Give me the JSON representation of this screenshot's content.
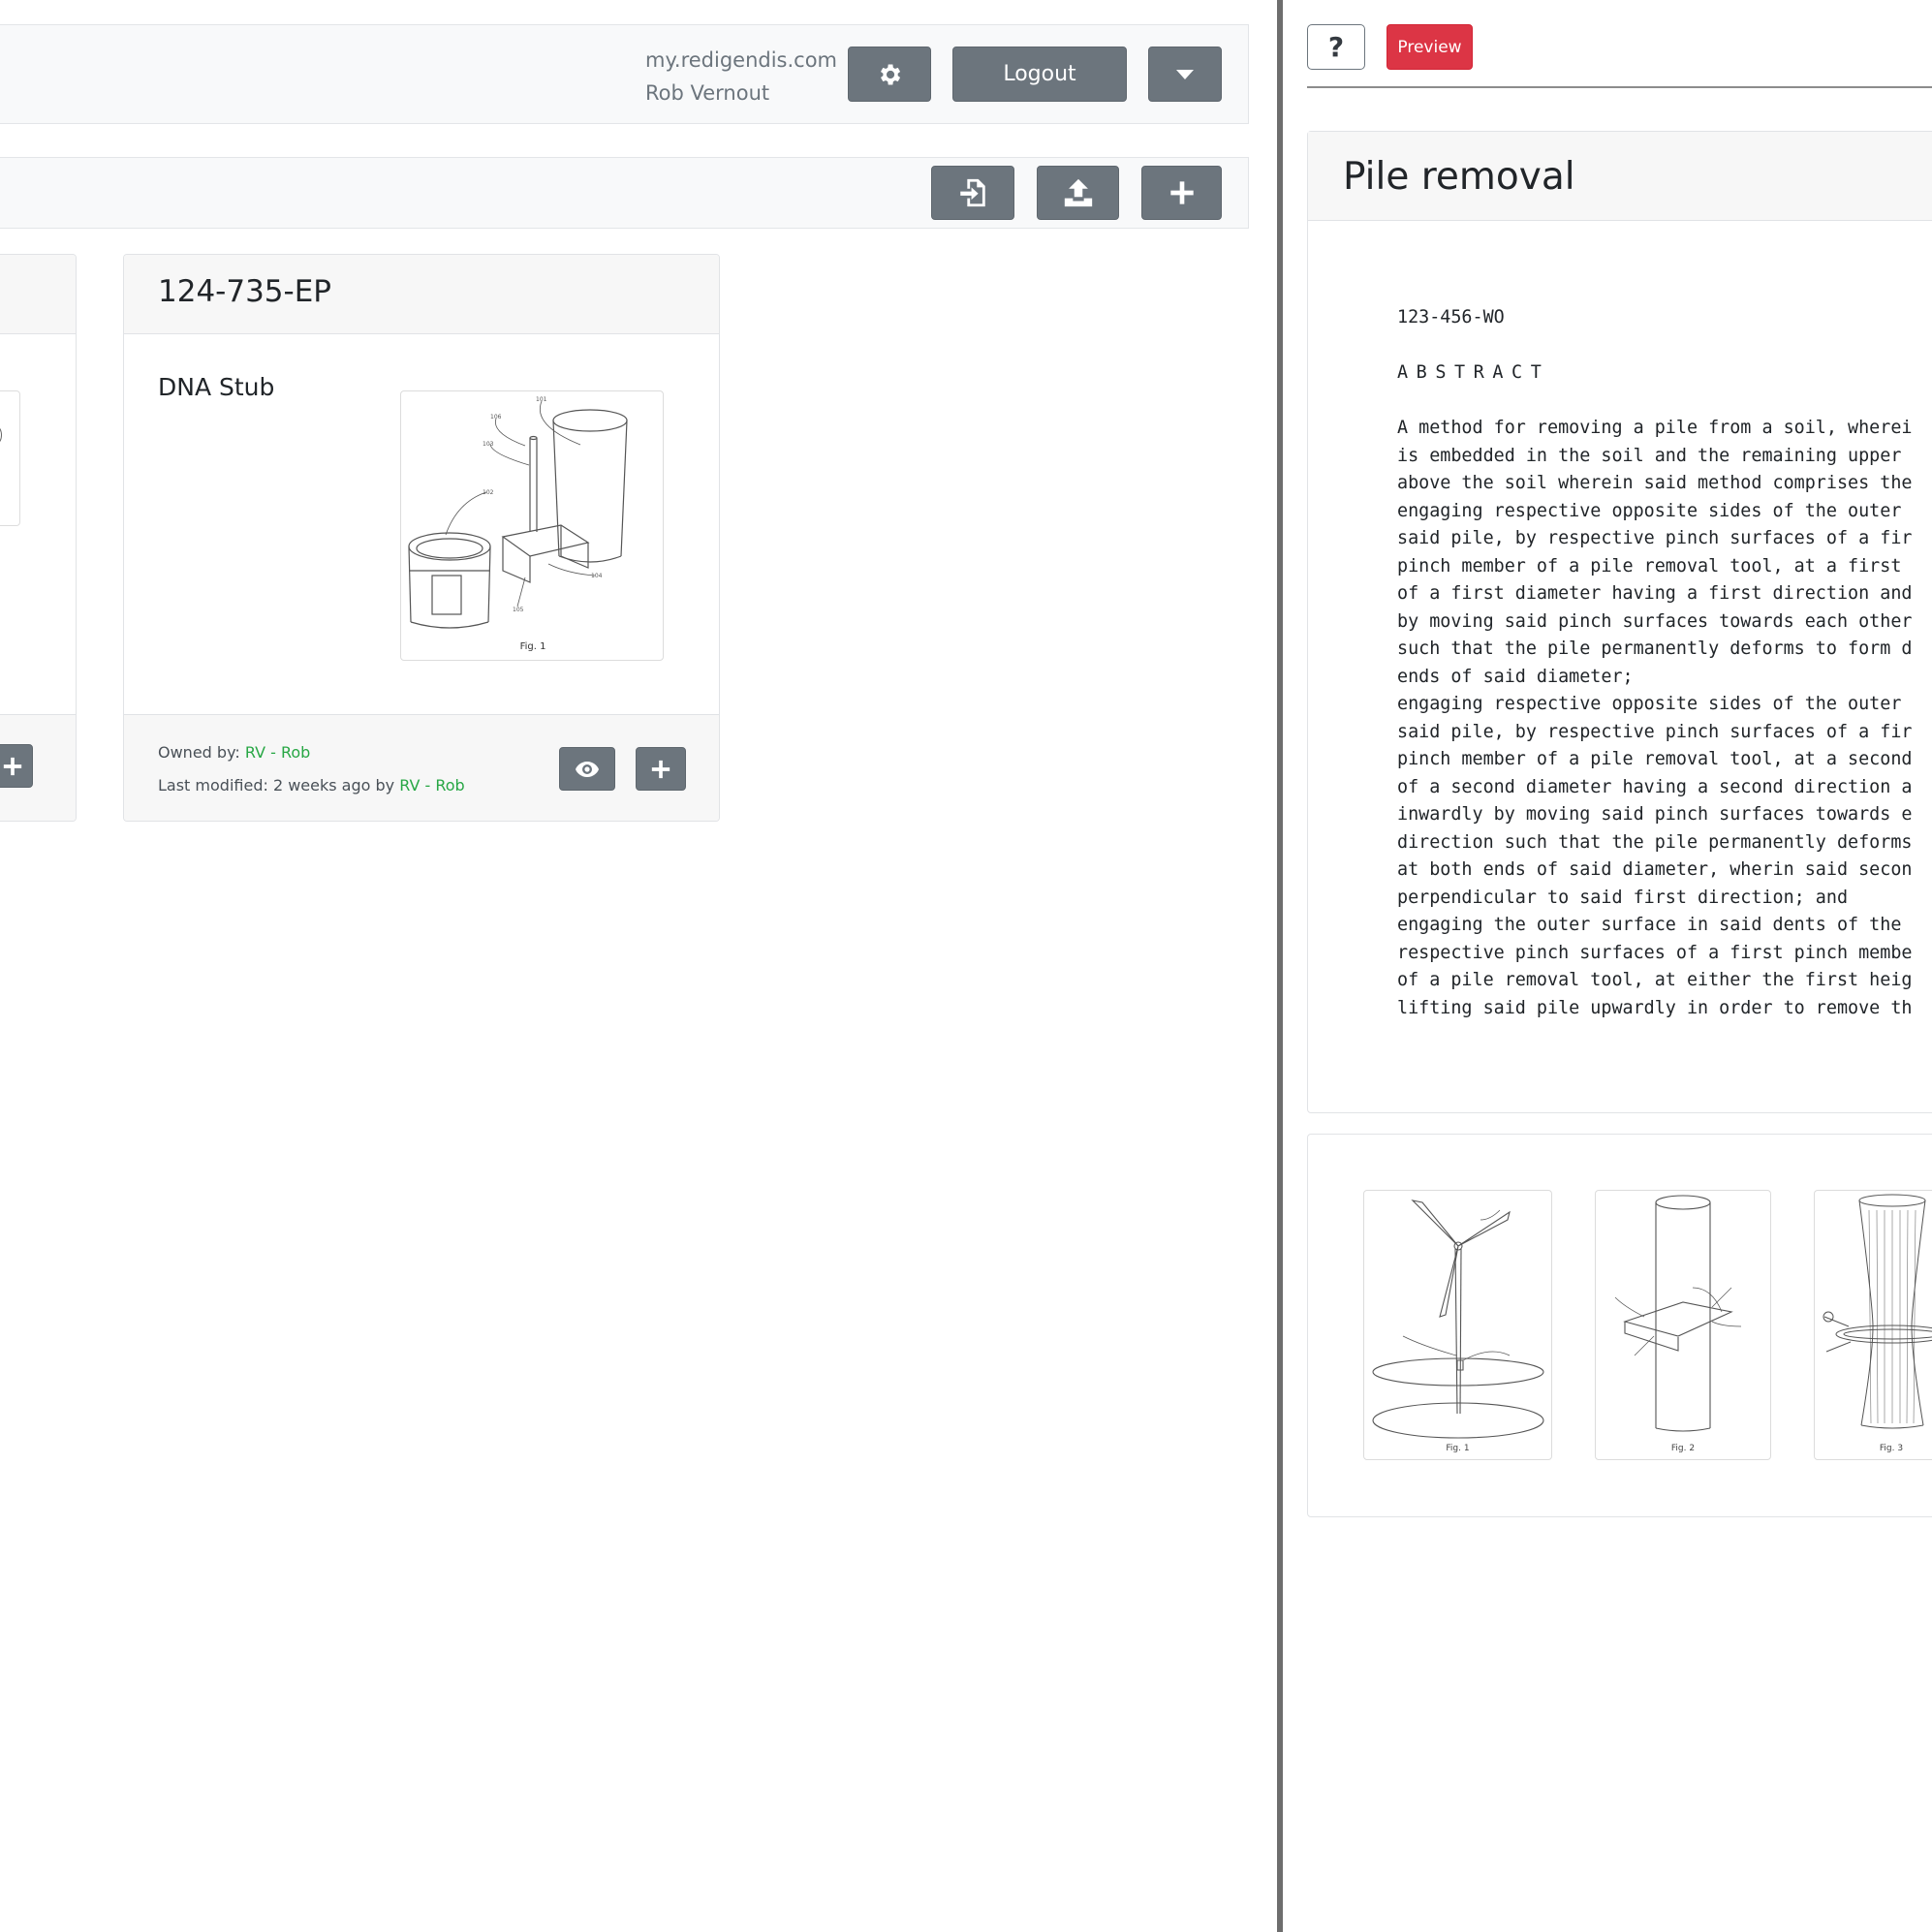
{
  "header": {
    "domain": "my.redigendis.com",
    "user_name": "Rob Vernout",
    "logout_label": "Logout",
    "settings_icon": "gear-icon",
    "dropdown_icon": "caret-down-icon"
  },
  "toolbar": {
    "import_icon": "file-import-icon",
    "upload_icon": "upload-icon",
    "add_icon": "plus-icon"
  },
  "card": {
    "title": "124-735-EP",
    "subtitle": "DNA Stub",
    "figure_caption": "Fig. 1",
    "figure_labels": [
      "101",
      "106",
      "103",
      "102",
      "104",
      "105"
    ],
    "owned_by_label": "Owned by:",
    "owner": "RV - Rob",
    "last_modified_label": "Last modified: 2 weeks ago by",
    "modified_by": "RV - Rob"
  },
  "right": {
    "help_label": "?",
    "preview_label": "Preview",
    "doc_title": "Pile removal",
    "doc_number": "123-456-WO",
    "abstract_heading": "ABSTRACT",
    "abstract_text": "A method for removing a pile from a soil, wherei\nis embedded in the soil and the remaining upper\nabove the soil wherein said method comprises the\nengaging respective opposite sides of the outer\nsaid pile, by respective pinch surfaces of a fir\npinch member of a pile removal tool, at a first\nof a first diameter having a first direction and\nby moving said pinch surfaces towards each other\nsuch that the pile permanently deforms to form d\nends of said diameter;\nengaging respective opposite sides of the outer\nsaid pile, by respective pinch surfaces of a fir\npinch member of a pile removal tool, at a second\nof a second diameter having a second direction a\ninwardly by moving said pinch surfaces towards e\ndirection such that the pile permanently deforms\nat both ends of said diameter, wherin said secon\nperpendicular to said first direction; and\nengaging the outer surface in said dents of the\nrespective pinch surfaces of a first pinch membe\nof a pile removal tool, at either the first heig\nlifting said pile upwardly in order to remove th",
    "figures": [
      {
        "caption": "Fig. 1"
      },
      {
        "caption": "Fig. 2"
      },
      {
        "caption": "Fig. 3"
      }
    ]
  }
}
